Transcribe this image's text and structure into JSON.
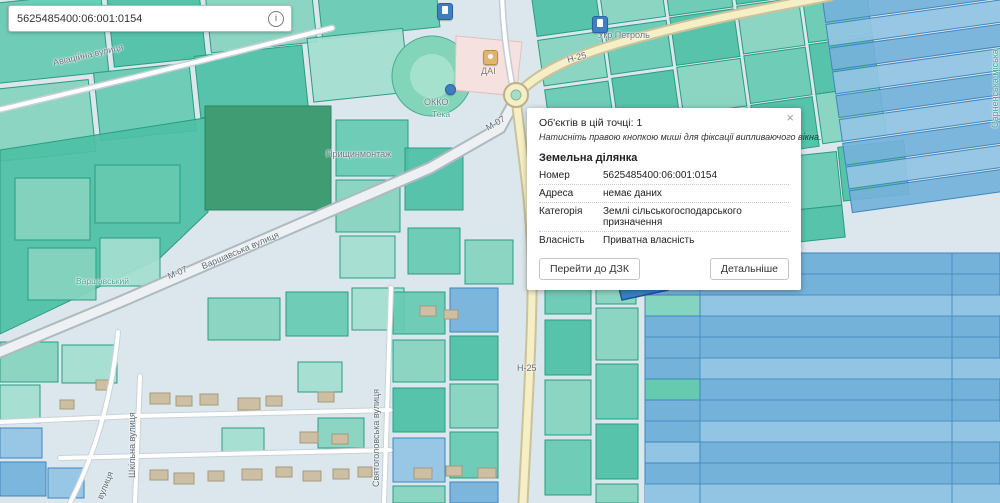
{
  "search": {
    "value": "5625485400:06:001:0154",
    "info_icon": "i"
  },
  "popup": {
    "count_line": "Об'єктів в цій точці: 1",
    "hint": "Натисніть правою кнопкою миші для фіксації випливаючого вікна.",
    "close_icon": "×",
    "section_title": "Земельна ділянка",
    "fields": [
      {
        "label": "Номер",
        "value": "5625485400:06:001:0154"
      },
      {
        "label": "Адреса",
        "value": "немає даних"
      },
      {
        "label": "Категорія",
        "value": "Землі сільськогосподарського призначення"
      },
      {
        "label": "Власність",
        "value": "Приватна власність"
      }
    ],
    "buttons": {
      "dzk": "Перейти до ДЗК",
      "details": "Детальніше"
    }
  },
  "map": {
    "labels": [
      {
        "text": "Авіаційна вулиця"
      },
      {
        "text": "Прищинмонтаж"
      },
      {
        "text": "М-07"
      },
      {
        "text": "Варшавська вулиця"
      },
      {
        "text": "М-07"
      },
      {
        "text": "Варшавський"
      },
      {
        "text": "ОККО"
      },
      {
        "text": "Тека"
      },
      {
        "text": "ДАІ"
      },
      {
        "text": "Укр Петроль"
      },
      {
        "text": "Н-25"
      },
      {
        "text": "Н-25"
      },
      {
        "text": "Шкільна вулиця"
      },
      {
        "text": "вулиця"
      },
      {
        "text": "Святоголовська вулиця"
      },
      {
        "text": "Сарненська міська"
      }
    ],
    "colors": {
      "parcel_teal": "#4cc0a4",
      "parcel_blue": "#74b2da",
      "selected_parcel": "#2d7fc6",
      "road_h25": "#f6eec5",
      "forest_green": "#3f9c73"
    }
  }
}
